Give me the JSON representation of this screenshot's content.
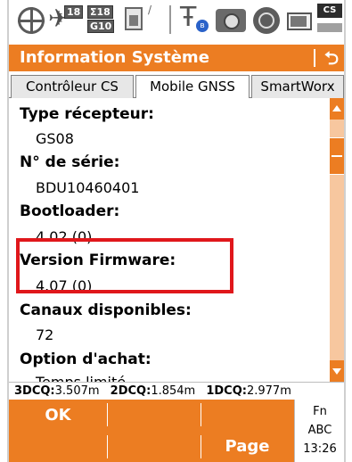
{
  "status_bar": {
    "sat_tracked": "18",
    "sat_total_top": "Σ18",
    "sat_total_bottom": "G10",
    "cs_label": "CS"
  },
  "title_bar": {
    "title": "Information Système",
    "back_icon": "back-arrow-icon"
  },
  "tabs": [
    {
      "label": "Contrôleur CS",
      "active": false
    },
    {
      "label": "Mobile GNSS",
      "active": true
    },
    {
      "label": "SmartWorx",
      "active": false
    }
  ],
  "fields": [
    {
      "label": "Type récepteur:",
      "value": "GS08"
    },
    {
      "label": "N° de série:",
      "value": "BDU10460401"
    },
    {
      "label": "Bootloader:",
      "value": "4.02 (0)"
    },
    {
      "label": "Version Firmware:",
      "value": "4.07 (0)"
    },
    {
      "label": "Canaux disponibles:",
      "value": "72"
    },
    {
      "label": "Option d'achat:",
      "value": "Temps limité"
    }
  ],
  "highlight_color": "#e0171b",
  "dop": {
    "d3_label": "3DCQ:",
    "d3_value": "3.507m",
    "d2_label": "2DCQ:",
    "d2_value": "1.854m",
    "d1_label": "1DCQ:",
    "d1_value": "2.977m"
  },
  "softkeys": {
    "f1": "OK",
    "page": "Page",
    "fn": "Fn",
    "abc": "ABC",
    "time": "13:26"
  },
  "colors": {
    "accent": "#ec7d22",
    "scroll_track": "#f7c79f"
  }
}
